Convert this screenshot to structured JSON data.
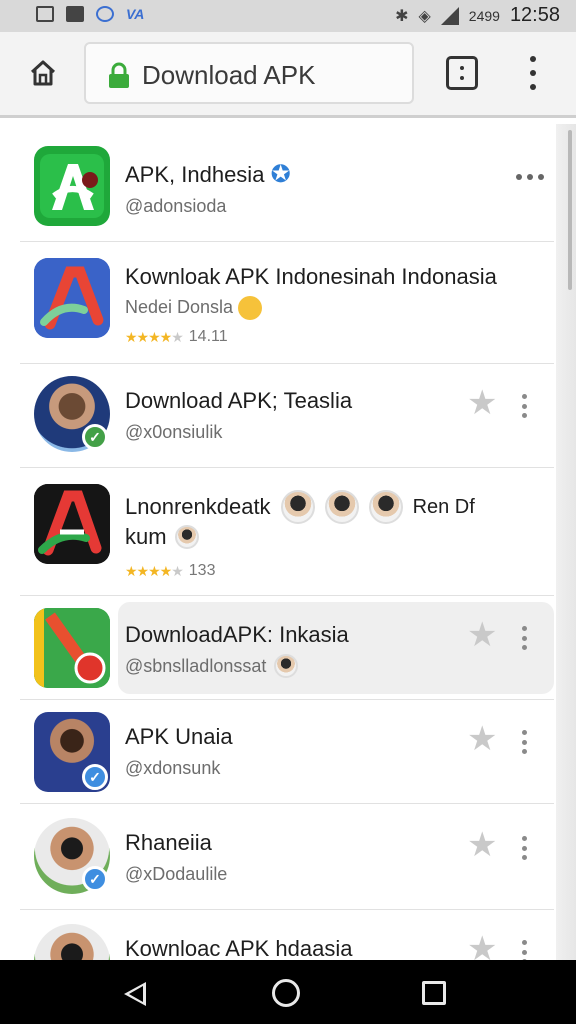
{
  "status_bar": {
    "brand": "VA",
    "time": "12:58",
    "signal_text": "2499"
  },
  "browser": {
    "url": "Download APK",
    "icons": [
      "home-icon",
      "lock-icon",
      "tabs-icon",
      "menu-icon"
    ]
  },
  "results": [
    {
      "title": "APK, Indhesia",
      "handle": "@adonsioda",
      "verified_star": true
    },
    {
      "title": "Kownloak APK Indonesinah Indonasia",
      "sub": "Nedei Donsla",
      "rating_text": "14.11"
    },
    {
      "title": "Download APK; Teaslia",
      "handle": "@x0onsiulik"
    },
    {
      "title": "Lnonrenkdeatk",
      "title_tail": "Ren Df",
      "title2": "kum",
      "rating_text": "133"
    },
    {
      "title": "DownloadAPK: Inkasia",
      "handle": "@sbnslladlonssat"
    },
    {
      "title": "APK Unaia",
      "handle": "@xdonsunk"
    },
    {
      "title": "Rhaneiia",
      "handle": "@xDodaulile"
    },
    {
      "title": "Kownloac APK hdaasia"
    }
  ],
  "nav": {
    "icons": [
      "back-icon",
      "home-circle-icon",
      "recents-icon"
    ]
  },
  "colors": {
    "accent_blue": "#3f8ee0",
    "star_gold": "#f3b624",
    "status_bar_bg": "#d9d9d9",
    "toolbar_bg": "#f3f3f3"
  }
}
